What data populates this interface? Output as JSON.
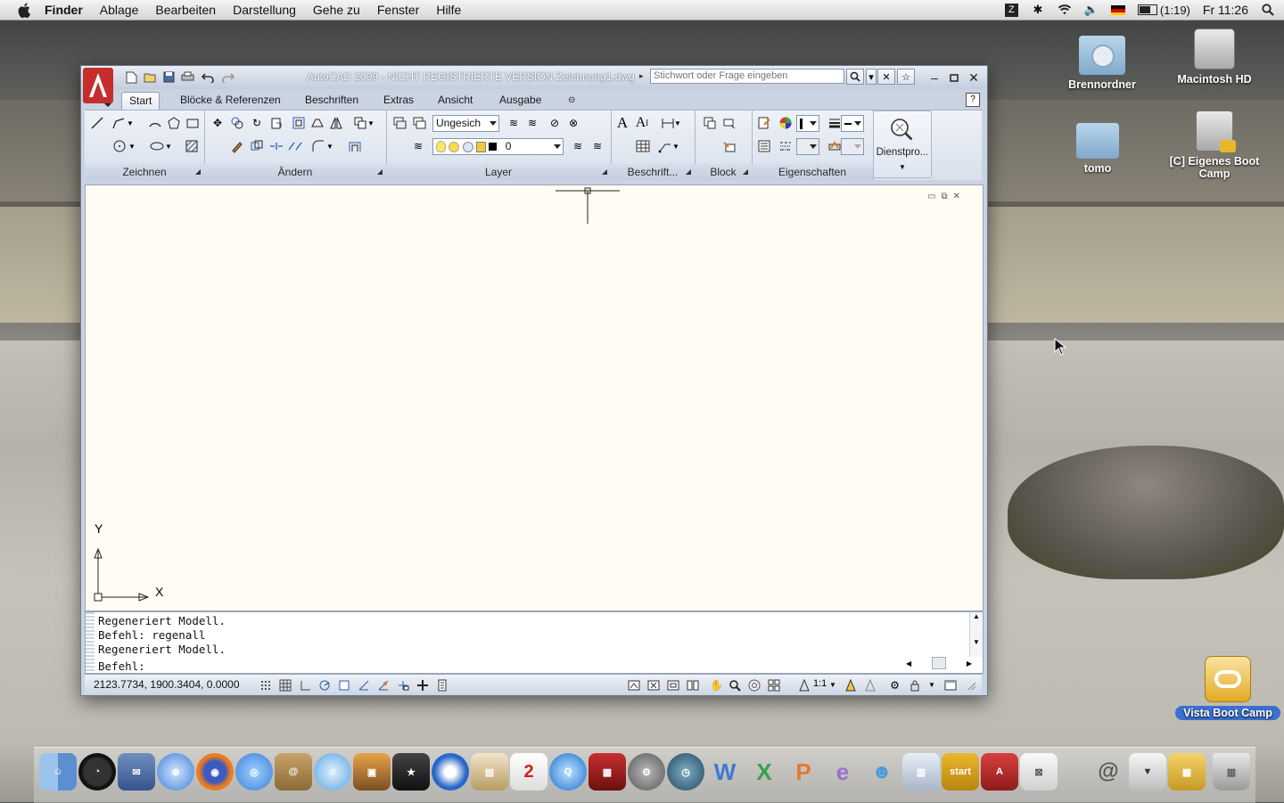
{
  "menubar": {
    "app": "Finder",
    "items": [
      "Ablage",
      "Bearbeiten",
      "Darstellung",
      "Gehe zu",
      "Fenster",
      "Hilfe"
    ],
    "battery": "(1:19)",
    "clock": "Fr 11:26"
  },
  "desktop": {
    "icons": [
      {
        "label": "Brennordner"
      },
      {
        "label": "Macintosh HD"
      },
      {
        "label": "tomo"
      },
      {
        "label": "[C] Eigenes Boot Camp"
      },
      {
        "label": "Vista Boot Camp"
      }
    ]
  },
  "autocad": {
    "title_prefix": "AutoCAD 2009 - NICHT REGISTRIERTE VERSION",
    "title_file": "Zeichnung1.dwg",
    "search_placeholder": "Stichwort oder Frage eingeben",
    "tabs": [
      "Start",
      "Blöcke & Referenzen",
      "Beschriften",
      "Extras",
      "Ansicht",
      "Ausgabe"
    ],
    "panels": {
      "draw": "Zeichnen",
      "modify": "Ändern",
      "layer": "Layer",
      "annotate": "Beschrift...",
      "block": "Block",
      "properties": "Eigenschaften",
      "utilities": "Dienstpro..."
    },
    "layer_state": "Ungesich",
    "layer_current": "0",
    "ucs": {
      "x": "X",
      "y": "Y"
    },
    "command_history": [
      "Regeneriert Modell.",
      "Befehl: regenall",
      "Regeneriert Modell."
    ],
    "command_prompt": "Befehl:",
    "coordinates": "2123.7734, 1900.3404, 0.0000",
    "annotation_scale": "1:1"
  }
}
